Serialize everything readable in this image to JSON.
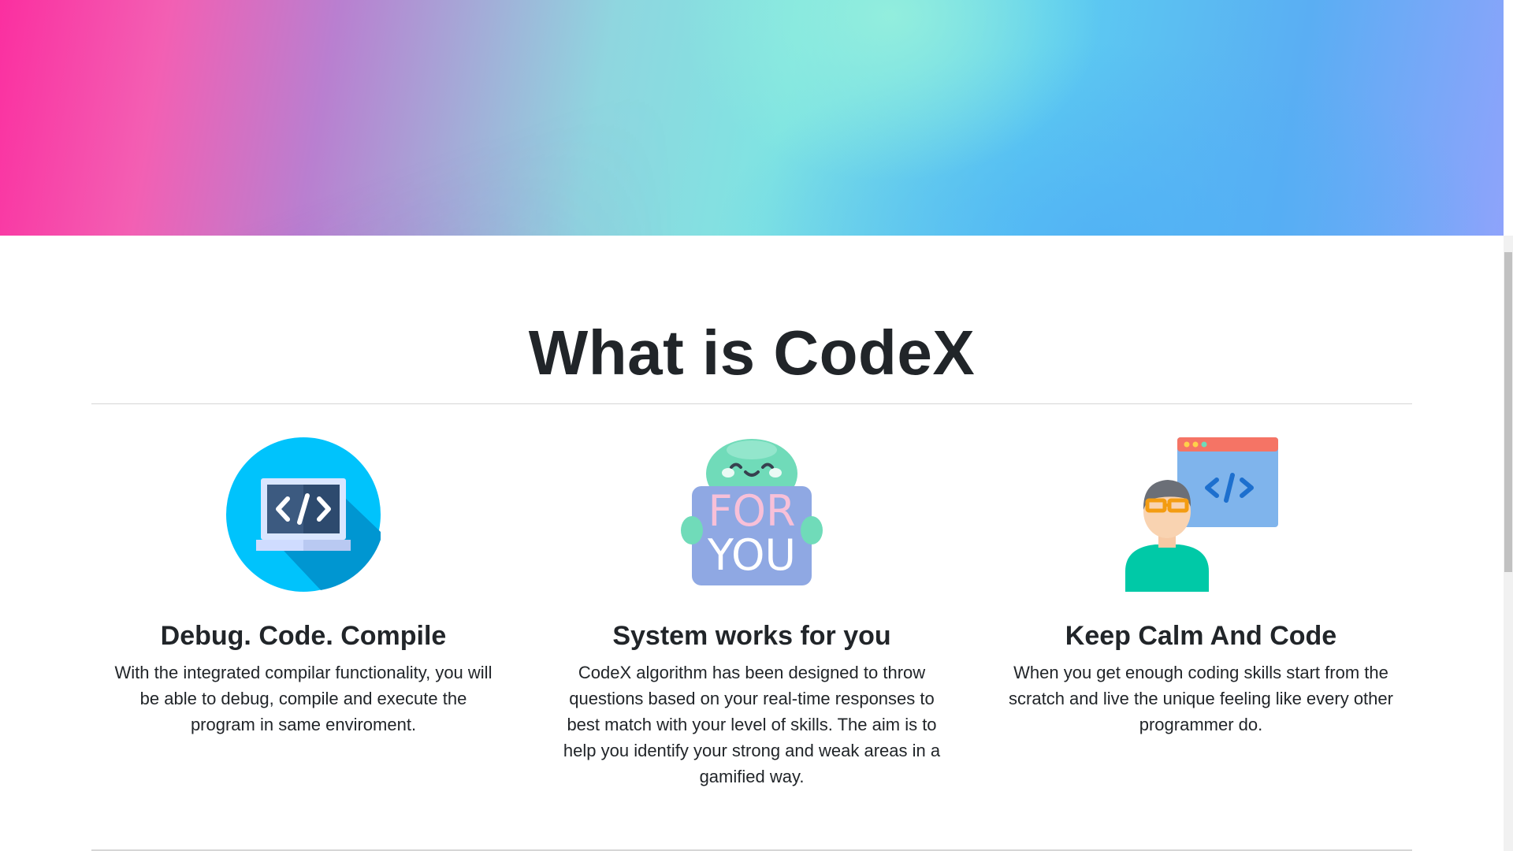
{
  "section": {
    "title": "What is CodeX",
    "features": [
      {
        "icon": "laptop-code-icon",
        "title": "Debug. Code. Compile",
        "text": "With the integrated compilar functionality, you will be able to debug, compile and execute the program in same enviroment."
      },
      {
        "icon": "for-you-sign-icon",
        "title": "System works for you",
        "text": "CodeX algorithm has been designed to throw questions based on your real-time responses to best match with your level of skills. The aim is to help you identify your strong and weak areas in a gamified way.",
        "sign_line1": "FOR",
        "sign_line2": "YOU"
      },
      {
        "icon": "programmer-window-icon",
        "title": "Keep Calm And Code",
        "text": "When you get enough coding skills start from the scratch and live the unique feeling like every other programmer do."
      }
    ]
  },
  "colors": {
    "heading": "#212529",
    "accent_blue": "#00c3fc",
    "divider": "#d6d6d6"
  }
}
